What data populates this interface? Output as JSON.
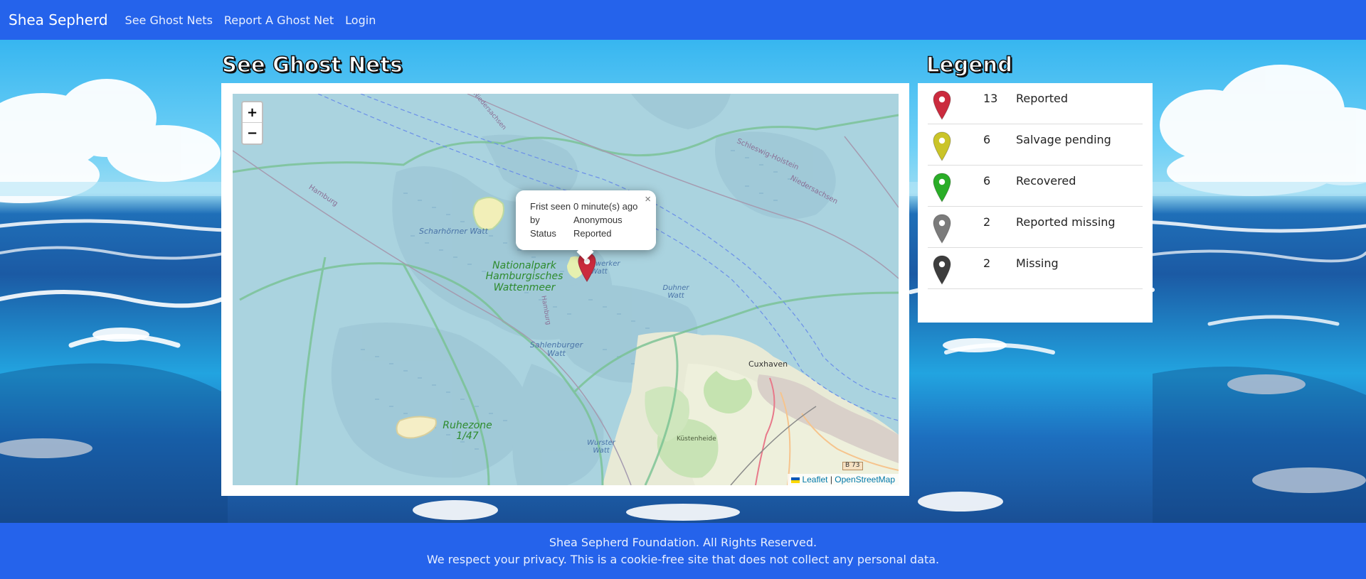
{
  "navbar": {
    "brand": "Shea Sepherd",
    "links": [
      "See Ghost Nets",
      "Report A Ghost Net",
      "Login"
    ]
  },
  "main": {
    "title": "See Ghost Nets"
  },
  "map": {
    "zoom_in": "+",
    "zoom_out": "−",
    "popup": {
      "close": "×",
      "rows": [
        {
          "key": "Frist seen",
          "value": "0 minute(s) ago"
        },
        {
          "key": "by",
          "value": "Anonymous"
        },
        {
          "key": "Status",
          "value": "Reported"
        }
      ]
    },
    "labels": {
      "national_park": "Nationalpark Hamburgisches Wattenmeer",
      "scharhorner": "Scharhörner Watt",
      "neuwerker": "Neuwerker Watt",
      "duhner": "Duhner Watt",
      "sahlenburger": "Sahlenburger Watt",
      "wurster": "Wurster Watt",
      "ruhezone": "Ruhezone 1/47",
      "cuxhaven": "Cuxhaven",
      "kustenheide": "Küstenheide",
      "hamburg_border": "Hamburg",
      "hamburg_v": "Hamburg",
      "niedersachsen_top": "Niedersachsen",
      "niedersachsen_right": "Niedersachsen",
      "schleswig": "Schleswig-Holstein",
      "b73": "B 73"
    },
    "attribution": {
      "leaflet": "Leaflet",
      "sep": "|",
      "osm": "OpenStreetMap"
    }
  },
  "legend": {
    "title": "Legend",
    "items": [
      {
        "count": "13",
        "label": "Reported",
        "color": "#cb2b3e"
      },
      {
        "count": "6",
        "label": "Salvage pending",
        "color": "#cac428"
      },
      {
        "count": "6",
        "label": "Recovered",
        "color": "#2aad27"
      },
      {
        "count": "2",
        "label": "Reported missing",
        "color": "#7b7b7b"
      },
      {
        "count": "2",
        "label": "Missing",
        "color": "#3d3d3d"
      }
    ]
  },
  "footer": {
    "line1": "Shea Sepherd Foundation. All Rights Reserved.",
    "line2": "We respect your privacy. This is a cookie-free site that does not collect any personal data."
  }
}
